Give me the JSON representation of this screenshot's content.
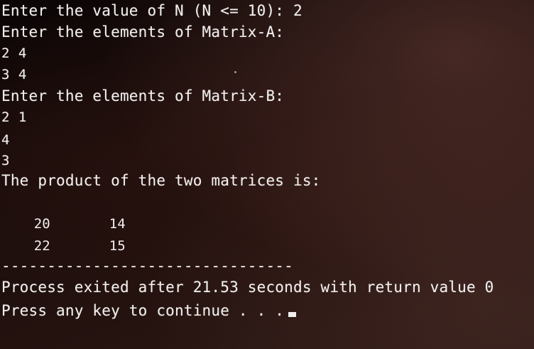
{
  "console": {
    "prompt_n": "Enter the value of N (N <= 10): 2",
    "prompt_a": "Enter the elements of Matrix-A:",
    "a_row1": "2 4",
    "a_row2": "3 4",
    "prompt_b": "Enter the elements of Matrix-B:",
    "b_row1": "2 1",
    "b_line2": "4",
    "b_line3": "3",
    "product_header": "The product of the two matrices is:",
    "product_rows": [
      {
        "c1": "20",
        "c2": "14"
      },
      {
        "c1": "22",
        "c2": "15"
      }
    ],
    "separator": "--------------------------------",
    "exit_message": "Process exited after 21.53 seconds with return value 0",
    "continue_prompt": "Press any key to continue . . ."
  }
}
